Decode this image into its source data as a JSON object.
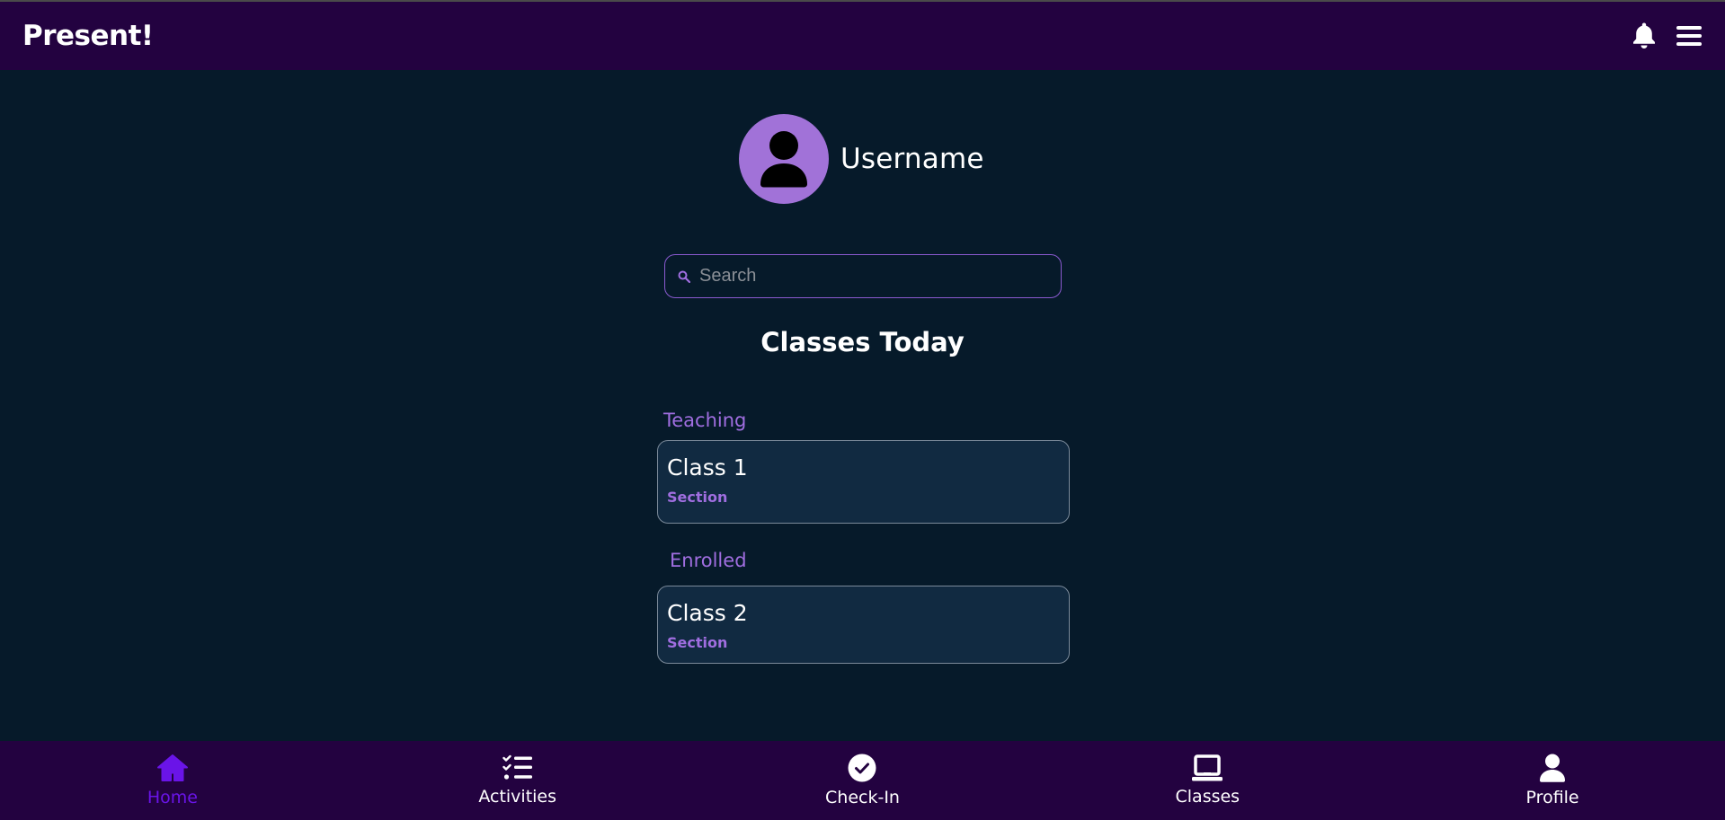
{
  "app": {
    "title": "Present!"
  },
  "profile": {
    "username": "Username"
  },
  "search": {
    "placeholder": "Search"
  },
  "main": {
    "heading": "Classes Today",
    "groups": [
      {
        "label": "Teaching",
        "classes": [
          {
            "name": "Class 1",
            "section": "Section"
          }
        ]
      },
      {
        "label": "Enrolled",
        "classes": [
          {
            "name": "Class 2",
            "section": "Section"
          }
        ]
      }
    ]
  },
  "nav": {
    "items": [
      {
        "label": "Home",
        "icon": "home-icon",
        "active": true
      },
      {
        "label": "Activities",
        "icon": "checklist-icon",
        "active": false
      },
      {
        "label": "Check-In",
        "icon": "check-circle-icon",
        "active": false
      },
      {
        "label": "Classes",
        "icon": "laptop-icon",
        "active": false
      },
      {
        "label": "Profile",
        "icon": "person-icon",
        "active": false
      }
    ]
  },
  "colors": {
    "header_bg": "#230240",
    "page_bg": "#061a2a",
    "accent": "#a06ee0",
    "avatar_bg": "#a172d8",
    "active_nav": "#6a14e8"
  }
}
